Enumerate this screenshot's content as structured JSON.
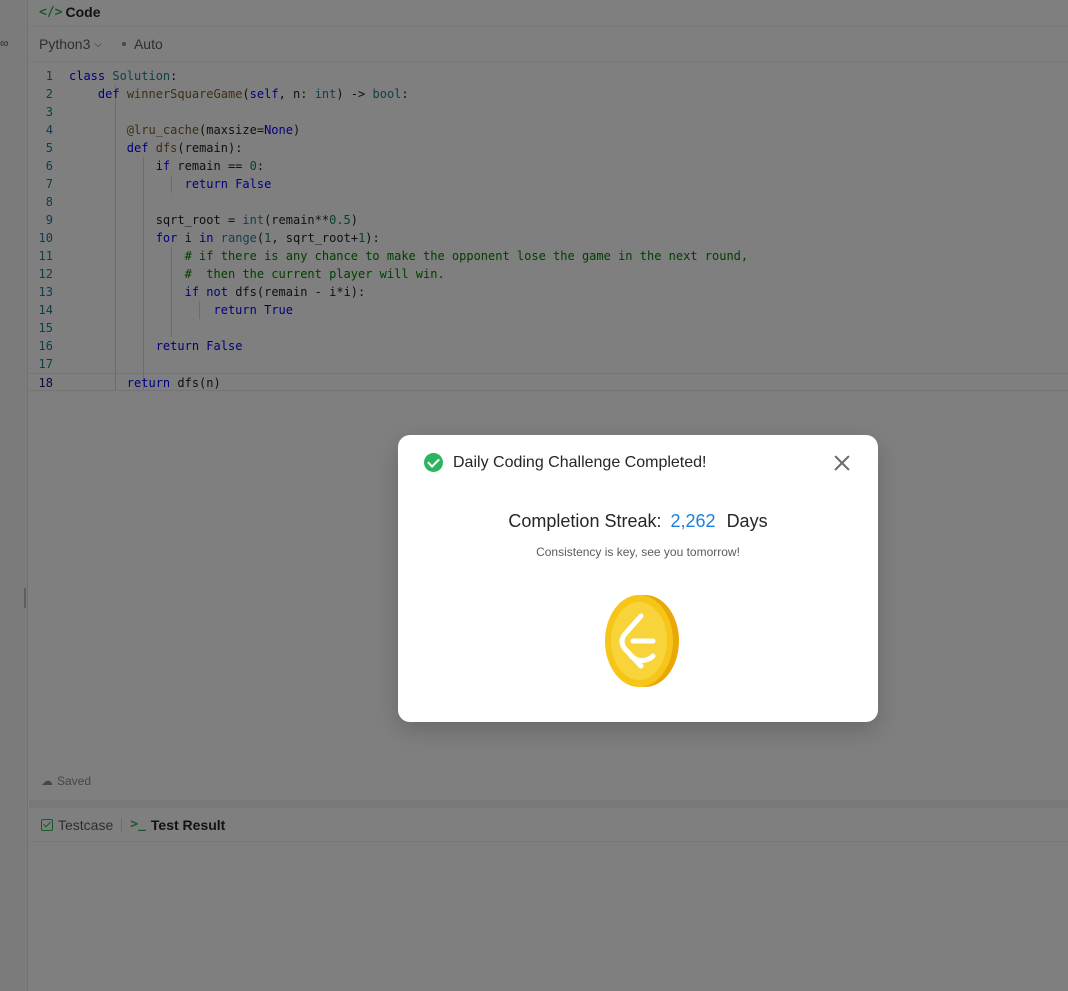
{
  "header": {
    "title": "Code",
    "code_icon": "</>"
  },
  "toolbar": {
    "language": "Python3",
    "mode": "Auto"
  },
  "editor": {
    "lines": [
      "1",
      "2",
      "3",
      "4",
      "5",
      "6",
      "7",
      "8",
      "9",
      "10",
      "11",
      "12",
      "13",
      "14",
      "15",
      "16",
      "17",
      "18"
    ]
  },
  "status": {
    "saved": "Saved"
  },
  "result_tabs": {
    "testcase": "Testcase",
    "test_result": "Test Result",
    "terminal_glyph": ">_"
  },
  "modal": {
    "title": "Daily Coding Challenge Completed!",
    "streak_label": "Completion Streak:",
    "streak_value": "2,262",
    "streak_unit": "Days",
    "tagline": "Consistency is key, see you tomorrow!"
  },
  "colors": {
    "accent_green": "#2db55d",
    "streak_blue": "#1a7fe0",
    "coin_gold": "#f5c518"
  }
}
